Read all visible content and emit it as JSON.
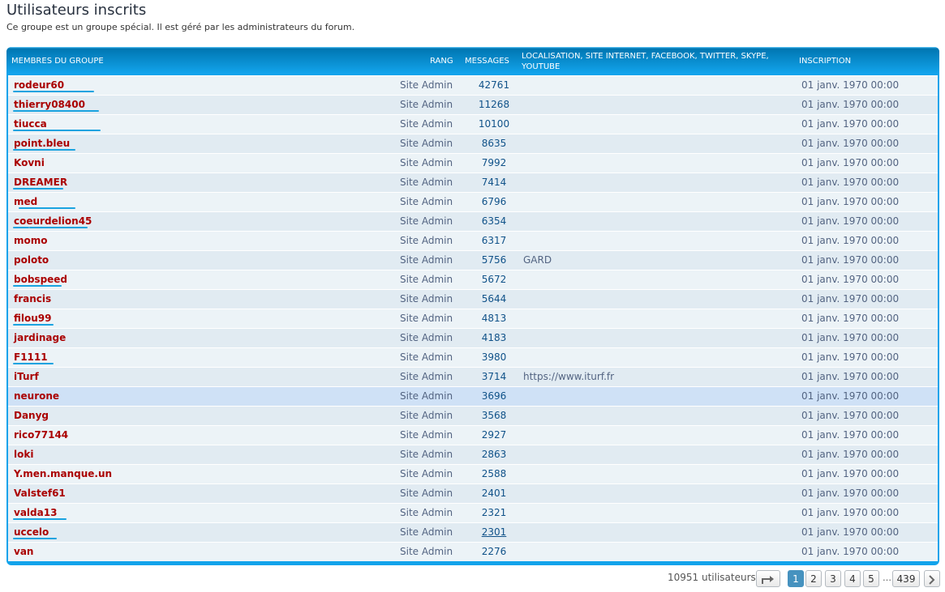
{
  "header": {
    "title": "Utilisateurs inscrits",
    "description": "Ce groupe est un groupe spécial. Il est géré par les administrateurs du forum."
  },
  "table": {
    "columns": {
      "member": "MEMBRES DU GROUPE",
      "rank": "RANG",
      "posts": "MESSAGES",
      "location": "LOCALISATION, SITE INTERNET, FACEBOOK, TWITTER, SKYPE, YOUTUBE",
      "joined": "INSCRIPTION"
    },
    "rows": [
      {
        "name": "rodeur60",
        "rank": "Site Admin",
        "posts": "42761",
        "location": "",
        "joined": "01 janv. 1970 00:00"
      },
      {
        "name": "thierry08400",
        "rank": "Site Admin",
        "posts": "11268",
        "location": "",
        "joined": "01 janv. 1970 00:00"
      },
      {
        "name": "tiucca",
        "rank": "Site Admin",
        "posts": "10100",
        "location": "",
        "joined": "01 janv. 1970 00:00"
      },
      {
        "name": "point.bleu",
        "rank": "Site Admin",
        "posts": "8635",
        "location": "",
        "joined": "01 janv. 1970 00:00"
      },
      {
        "name": "Kovni",
        "rank": "Site Admin",
        "posts": "7992",
        "location": "",
        "joined": "01 janv. 1970 00:00"
      },
      {
        "name": "DREAMER",
        "rank": "Site Admin",
        "posts": "7414",
        "location": "",
        "joined": "01 janv. 1970 00:00"
      },
      {
        "name": "med",
        "rank": "Site Admin",
        "posts": "6796",
        "location": "",
        "joined": "01 janv. 1970 00:00"
      },
      {
        "name": "coeurdelion45",
        "rank": "Site Admin",
        "posts": "6354",
        "location": "",
        "joined": "01 janv. 1970 00:00"
      },
      {
        "name": "momo",
        "rank": "Site Admin",
        "posts": "6317",
        "location": "",
        "joined": "01 janv. 1970 00:00"
      },
      {
        "name": "poloto",
        "rank": "Site Admin",
        "posts": "5756",
        "location": "GARD",
        "joined": "01 janv. 1970 00:00"
      },
      {
        "name": "bobspeed",
        "rank": "Site Admin",
        "posts": "5672",
        "location": "",
        "joined": "01 janv. 1970 00:00"
      },
      {
        "name": "francis",
        "rank": "Site Admin",
        "posts": "5644",
        "location": "",
        "joined": "01 janv. 1970 00:00"
      },
      {
        "name": "filou99",
        "rank": "Site Admin",
        "posts": "4813",
        "location": "",
        "joined": "01 janv. 1970 00:00"
      },
      {
        "name": "jardinage",
        "rank": "Site Admin",
        "posts": "4183",
        "location": "",
        "joined": "01 janv. 1970 00:00"
      },
      {
        "name": "F1111",
        "rank": "Site Admin",
        "posts": "3980",
        "location": "",
        "joined": "01 janv. 1970 00:00"
      },
      {
        "name": "iTurf",
        "rank": "Site Admin",
        "posts": "3714",
        "location": "https://www.iturf.fr",
        "joined": "01 janv. 1970 00:00"
      },
      {
        "name": "neurone",
        "rank": "Site Admin",
        "posts": "3696",
        "location": "",
        "joined": "01 janv. 1970 00:00"
      },
      {
        "name": "Danyg",
        "rank": "Site Admin",
        "posts": "3568",
        "location": "",
        "joined": "01 janv. 1970 00:00"
      },
      {
        "name": "rico77144",
        "rank": "Site Admin",
        "posts": "2927",
        "location": "",
        "joined": "01 janv. 1970 00:00"
      },
      {
        "name": "loki",
        "rank": "Site Admin",
        "posts": "2863",
        "location": "",
        "joined": "01 janv. 1970 00:00"
      },
      {
        "name": "Y.men.manque.un",
        "rank": "Site Admin",
        "posts": "2588",
        "location": "",
        "joined": "01 janv. 1970 00:00"
      },
      {
        "name": "Valstef61",
        "rank": "Site Admin",
        "posts": "2401",
        "location": "",
        "joined": "01 janv. 1970 00:00"
      },
      {
        "name": "valda13",
        "rank": "Site Admin",
        "posts": "2321",
        "location": "",
        "joined": "01 janv. 1970 00:00"
      },
      {
        "name": "uccelo",
        "rank": "Site Admin",
        "posts": "2301",
        "location": "",
        "joined": "01 janv. 1970 00:00"
      },
      {
        "name": "van",
        "rank": "Site Admin",
        "posts": "2276",
        "location": "",
        "joined": "01 janv. 1970 00:00"
      }
    ]
  },
  "footer": {
    "count": "10951 utilisateurs",
    "jump_icon": "jump-to-page-icon",
    "pages": [
      "1",
      "2",
      "3",
      "4",
      "5"
    ],
    "ellipsis": "…",
    "last_page": "439",
    "next_icon": "chevron-right-icon"
  },
  "colors": {
    "accent": "#12a3eb",
    "username": "#aa0000",
    "highlight_underline": "#1aa3e0"
  }
}
